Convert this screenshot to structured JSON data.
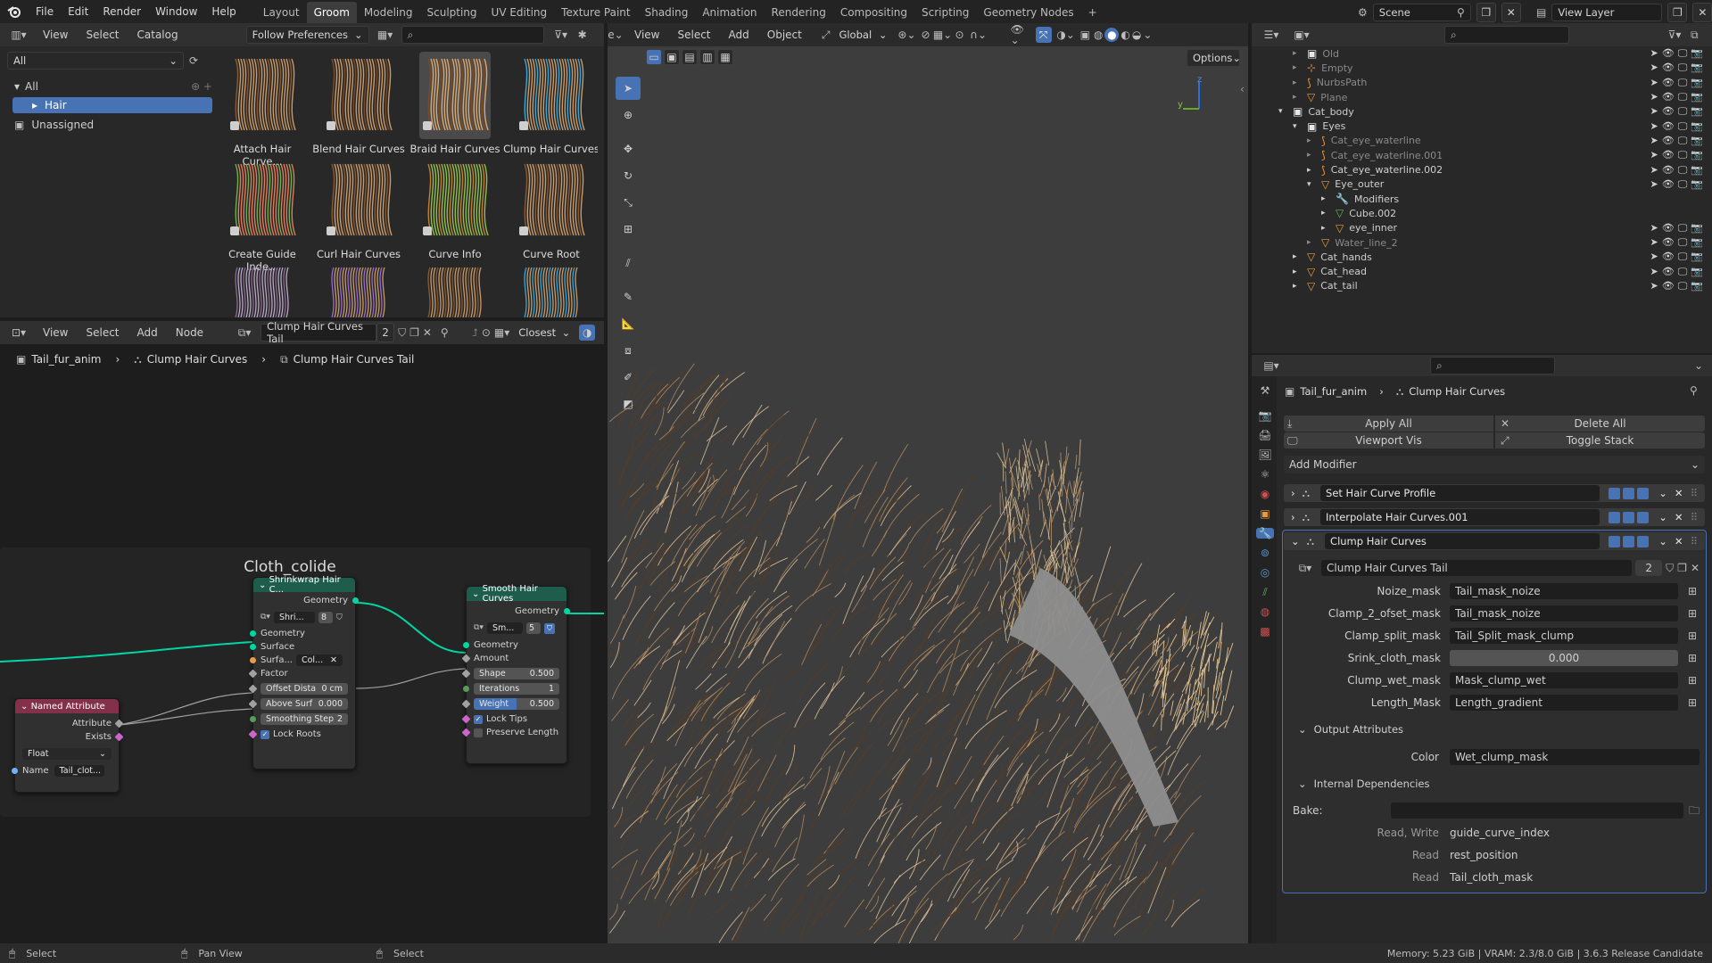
{
  "topbar": {
    "menus": [
      "File",
      "Edit",
      "Render",
      "Window",
      "Help"
    ],
    "workspaces": [
      "Layout",
      "Groom",
      "Modeling",
      "Sculpting",
      "UV Editing",
      "Texture Paint",
      "Shading",
      "Animation",
      "Rendering",
      "Compositing",
      "Scripting",
      "Geometry Nodes"
    ],
    "active_workspace": "Groom",
    "add_workspace": "+",
    "scene": "Scene",
    "view_layer": "View Layer"
  },
  "asset_browser": {
    "menus": [
      "View",
      "Select",
      "Catalog"
    ],
    "library": "Follow Preferences",
    "filter": "All",
    "catalog_root": "All",
    "catalogs": [
      "Hair",
      "Unassigned"
    ],
    "assets": [
      {
        "label": "Attach Hair Curve...",
        "icon": "hair-asset-icon"
      },
      {
        "label": "Blend Hair Curves",
        "icon": "hair-asset-icon"
      },
      {
        "label": "Braid Hair Curves",
        "icon": "hair-asset-icon"
      },
      {
        "label": "Clump Hair Curves",
        "icon": "hair-asset-icon"
      },
      {
        "label": "Create Guide Inde...",
        "icon": "hair-asset-icon"
      },
      {
        "label": "Curl Hair Curves",
        "icon": "hair-asset-icon"
      },
      {
        "label": "Curve Info",
        "icon": "hair-asset-icon"
      },
      {
        "label": "Curve Root",
        "icon": "hair-asset-icon"
      }
    ]
  },
  "viewport": {
    "menus": [
      "View",
      "Select",
      "Add",
      "Object"
    ],
    "transform": "Global",
    "options": "Options",
    "axis_y": "y",
    "axis_z": "z"
  },
  "node_editor": {
    "menus": [
      "View",
      "Select",
      "Add",
      "Node"
    ],
    "node_group": "Clump Hair Curves Tail",
    "users": "2",
    "snap": "Closest",
    "breadcrumb": [
      "Tail_fur_anim",
      "Clump Hair Curves",
      "Clump Hair Curves Tail"
    ],
    "frame_label": "Cloth_colide",
    "shrinkwrap": {
      "title": "Shrinkwrap Hair C...",
      "out": "Geometry",
      "group": "Shri...",
      "users": "8",
      "inputs": [
        "Geometry",
        "Surface",
        "Surfa...",
        "Factor"
      ],
      "surface_val": "Col...",
      "offset_label": "Offset Dista",
      "offset_val": "0 cm",
      "above_label": "Above Surf",
      "above_val": "0.000",
      "smooth_label": "Smoothing Step",
      "smooth_val": "2",
      "lock_roots": "Lock Roots"
    },
    "smooth": {
      "title": "Smooth Hair Curves",
      "out": "Geometry",
      "group": "Sm...",
      "users": "5",
      "inputs": [
        "Geometry",
        "Amount"
      ],
      "shape_label": "Shape",
      "shape_val": "0.500",
      "iter_label": "Iterations",
      "iter_val": "1",
      "weight_label": "Weight",
      "weight_val": "0.500",
      "lock_tips": "Lock Tips",
      "preserve": "Preserve Length"
    },
    "named_attr": {
      "title": "Named Attribute",
      "out1": "Attribute",
      "out2": "Exists",
      "type": "Float",
      "name_label": "Name",
      "name_val": "Tail_clot..."
    }
  },
  "outliner": {
    "rows": [
      {
        "name": "Old",
        "depth": 2,
        "dim": true
      },
      {
        "name": "Empty",
        "depth": 2,
        "dim": true
      },
      {
        "name": "NurbsPath",
        "depth": 2,
        "dim": true
      },
      {
        "name": "Plane",
        "depth": 2,
        "dim": true
      },
      {
        "name": "Cat_body",
        "depth": 1,
        "dim": false
      },
      {
        "name": "Eyes",
        "depth": 2,
        "dim": false
      },
      {
        "name": "Cat_eye_waterline",
        "depth": 3,
        "dim": true
      },
      {
        "name": "Cat_eye_waterline.001",
        "depth": 3,
        "dim": true
      },
      {
        "name": "Cat_eye_waterline.002",
        "depth": 3,
        "dim": false
      },
      {
        "name": "Eye_outer",
        "depth": 3,
        "dim": false
      },
      {
        "name": "Modifiers",
        "depth": 4,
        "dim": false
      },
      {
        "name": "Cube.002",
        "depth": 4,
        "dim": false
      },
      {
        "name": "eye_inner",
        "depth": 4,
        "dim": false
      },
      {
        "name": "Water_line_2",
        "depth": 3,
        "dim": true
      },
      {
        "name": "Cat_hands",
        "depth": 2,
        "dim": false
      },
      {
        "name": "Cat_head",
        "depth": 2,
        "dim": false
      },
      {
        "name": "Cat_tail",
        "depth": 2,
        "dim": false
      }
    ]
  },
  "properties": {
    "breadcrumb": [
      "Tail_fur_anim",
      "Clump Hair Curves"
    ],
    "apply_all": "Apply All",
    "delete_all": "Delete All",
    "viewport_vis": "Viewport Vis",
    "toggle_stack": "Toggle Stack",
    "add_modifier": "Add Modifier",
    "modifiers": [
      "Set Hair Curve Profile",
      "Interpolate Hair Curves.001",
      "Clump Hair Curves"
    ],
    "node_group": "Clump Hair Curves Tail",
    "users": "2",
    "params": [
      {
        "label": "Noize_mask",
        "value": "Tail_mask_noize"
      },
      {
        "label": "Clamp_2_ofset_mask",
        "value": "Tail_mask_noize"
      },
      {
        "label": "Clamp_split_mask",
        "value": "Tail_Split_mask_clump"
      },
      {
        "label": "Srink_cloth_mask",
        "value": "0.000"
      },
      {
        "label": "Clump_wet_mask",
        "value": "Mask_clump_wet"
      },
      {
        "label": "Length_Mask",
        "value": "Length_gradient"
      }
    ],
    "output_attributes": "Output Attributes",
    "color_label": "Color",
    "color_value": "Wet_clump_mask",
    "internal_deps": "Internal Dependencies",
    "bake_label": "Bake:",
    "deps": [
      {
        "mode": "Read, Write",
        "name": "guide_curve_index"
      },
      {
        "mode": "Read",
        "name": "rest_position"
      },
      {
        "mode": "Read",
        "name": "Tail_cloth_mask"
      }
    ]
  },
  "statusbar": {
    "left": [
      "Select",
      "Pan View",
      "Select"
    ],
    "right": "Memory: 5.23 GiB | VRAM: 2.3/8.0 GiB | 3.6.3 Release Candidate"
  },
  "colors": {
    "accent": "#4772b3",
    "geometry_socket": "#00d6a3",
    "float_socket": "#a1a1a1",
    "attr_header": "#83314a",
    "fur": "#c9a57a"
  }
}
